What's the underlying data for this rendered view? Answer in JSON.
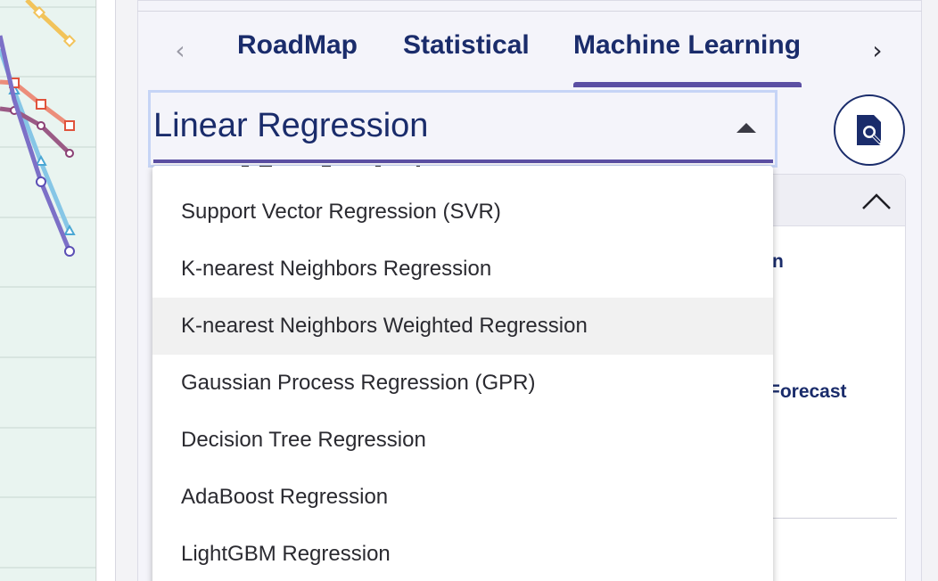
{
  "tabs": {
    "prev_icon": "chevron-left-icon",
    "next_icon": "chevron-right-icon",
    "items": [
      "RoadMap",
      "Statistical",
      "Machine Learning"
    ],
    "active": "Machine Learning"
  },
  "model_select": {
    "value": "Linear Regression",
    "caret_icon": "caret-up-icon"
  },
  "search_button": {
    "icon": "search-document-icon"
  },
  "dropdown": {
    "options": [
      "Support Vector Regression (SVR)",
      "K-nearest Neighbors Regression",
      "K-nearest Neighbors Weighted Regression",
      "Gaussian Process Regression (GPR)",
      "Decision Tree Regression",
      "AdaBoost Regression",
      "LightGBM Regression"
    ],
    "highlighted": "K-nearest Neighbors Weighted Regression"
  },
  "card": {
    "collapse_icon": "chevron-up-icon",
    "text_a": "n",
    "text_b": "Forecast"
  },
  "colors": {
    "brand": "#1a2c6b",
    "accent": "#5b4fa3",
    "chart_bg": "#e9f4f0"
  }
}
